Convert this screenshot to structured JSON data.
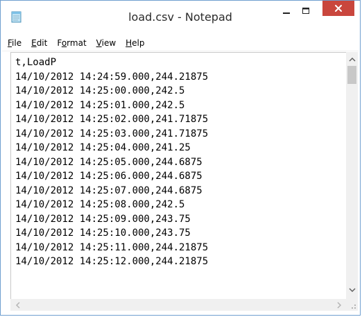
{
  "window": {
    "title": "load.csv - Notepad",
    "colors": {
      "close": "#c9463d",
      "border": "#6f9fcf"
    }
  },
  "icons": {
    "app": "notepad-icon",
    "minimize": "minimize-icon",
    "maximize": "maximize-icon",
    "close": "close-icon"
  },
  "menu": [
    {
      "label": "File",
      "key": "F"
    },
    {
      "label": "Edit",
      "key": "E"
    },
    {
      "label": "Format",
      "key": "o"
    },
    {
      "label": "View",
      "key": "V"
    },
    {
      "label": "Help",
      "key": "H"
    }
  ],
  "document": {
    "lines": [
      "t,LoadP",
      "14/10/2012 14:24:59.000,244.21875",
      "14/10/2012 14:25:00.000,242.5",
      "14/10/2012 14:25:01.000,242.5",
      "14/10/2012 14:25:02.000,241.71875",
      "14/10/2012 14:25:03.000,241.71875",
      "14/10/2012 14:25:04.000,241.25",
      "14/10/2012 14:25:05.000,244.6875",
      "14/10/2012 14:25:06.000,244.6875",
      "14/10/2012 14:25:07.000,244.6875",
      "14/10/2012 14:25:08.000,242.5",
      "14/10/2012 14:25:09.000,243.75",
      "14/10/2012 14:25:10.000,243.75",
      "14/10/2012 14:25:11.000,244.21875",
      "14/10/2012 14:25:12.000,244.21875"
    ]
  }
}
